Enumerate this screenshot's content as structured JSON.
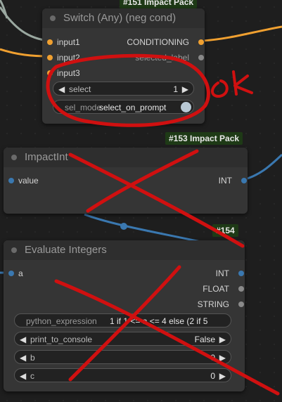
{
  "annotation": {
    "ok_text": "ok"
  },
  "switch_node": {
    "badge": "#151 Impact Pack",
    "title": "Switch (Any) (neg cond)",
    "inputs": [
      "input1",
      "input2",
      "input3"
    ],
    "outputs": [
      "CONDITIONING",
      "selected_label"
    ],
    "select_widget": {
      "label": "select",
      "value": "1"
    },
    "sel_mode_widget": {
      "label": "sel_mode",
      "value": "select_on_prompt"
    }
  },
  "impactint_node": {
    "badge": "#153 Impact Pack",
    "title": "ImpactInt",
    "input": "value",
    "output": "INT"
  },
  "evaluate_node": {
    "badge": "#154",
    "title": "Evaluate Integers",
    "input": "a",
    "outputs": [
      "INT",
      "FLOAT",
      "STRING"
    ],
    "python_expression": {
      "label": "python_expression",
      "value": "1 if 1 <= a <= 4 else (2 if 5"
    },
    "print_to_console": {
      "label": "print_to_console",
      "value": "False"
    },
    "b": {
      "label": "b",
      "value": "0"
    },
    "c": {
      "label": "c",
      "value": "0"
    }
  },
  "colors": {
    "conditioning_wire": "#f0a030",
    "int_wire": "#3a78b0",
    "annotation_red": "#d01010"
  }
}
